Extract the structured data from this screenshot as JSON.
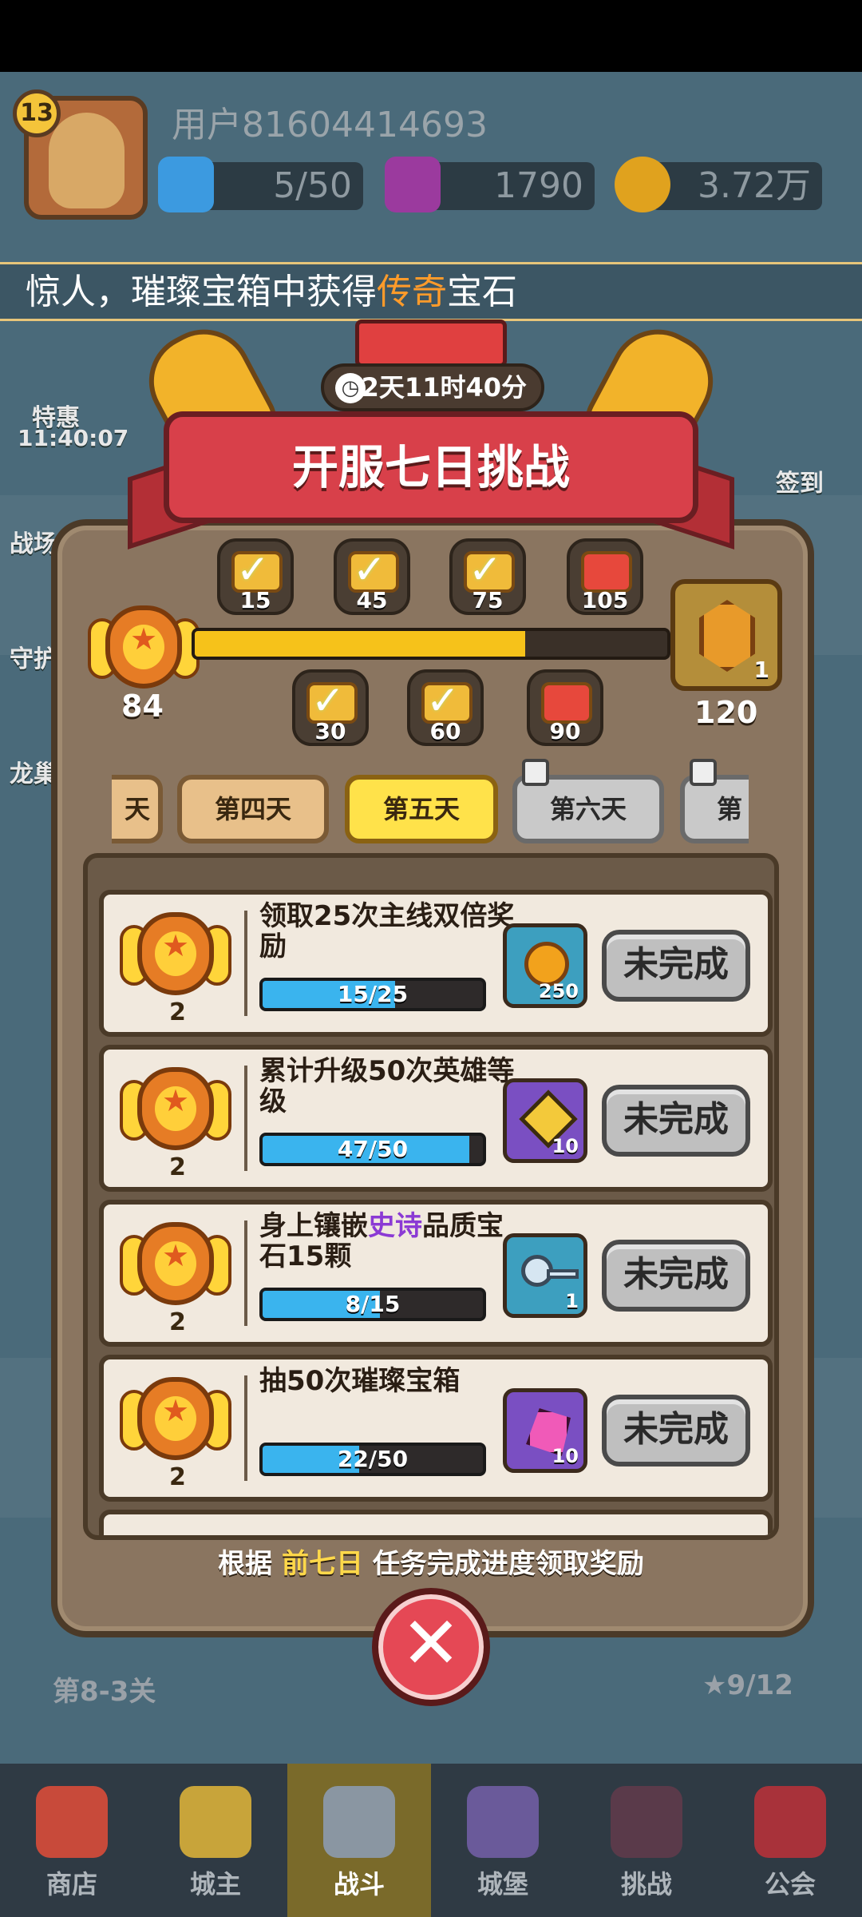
{
  "header": {
    "level": "13",
    "username": "用户81604414693",
    "energy": "5/50",
    "gems": "1790",
    "gold": "3.72万"
  },
  "marquee": {
    "prefix": "惊人，璀璨宝箱中获得",
    "highlight": "传奇",
    "suffix": "宝石"
  },
  "side": {
    "promo_label": "特惠",
    "promo_timer": "11:40:07",
    "brothers": "战场兄弟",
    "guard": "守护",
    "dragon": "龙巢",
    "signin": "签到"
  },
  "modal": {
    "timer": "2天11时40分",
    "title": "开服七日挑战",
    "current_points": "84",
    "max_points": "120",
    "progress_fraction": 0.7,
    "final_reward_count": "1",
    "milestones_top": [
      {
        "points": "15",
        "claimed": true
      },
      {
        "points": "45",
        "claimed": true
      },
      {
        "points": "75",
        "claimed": true
      },
      {
        "points": "105",
        "claimed": false
      }
    ],
    "milestones_bottom": [
      {
        "points": "30",
        "claimed": true
      },
      {
        "points": "60",
        "claimed": true
      },
      {
        "points": "90",
        "claimed": false
      }
    ],
    "tabs": [
      {
        "label": "天",
        "state": "day"
      },
      {
        "label": "第四天",
        "state": "day"
      },
      {
        "label": "第五天",
        "state": "active"
      },
      {
        "label": "第六天",
        "state": "locked"
      },
      {
        "label": "第七",
        "state": "locked"
      }
    ],
    "tasks": [
      {
        "title": "领取25次主线双倍奖励",
        "points": "2",
        "progress": "15/25",
        "ratio": 0.6,
        "reward_count": "250",
        "reward_icon": "gold-coin",
        "button": "未完成"
      },
      {
        "title": "累计升级50次英雄等级",
        "points": "2",
        "progress": "47/50",
        "ratio": 0.94,
        "reward_count": "10",
        "reward_icon": "mystery-puzzle",
        "button": "未完成"
      },
      {
        "title_pre": "身上镶嵌",
        "title_epic": "史诗",
        "title_post": "品质宝石15颗",
        "points": "2",
        "progress": "8/15",
        "ratio": 0.533,
        "reward_count": "1",
        "reward_icon": "key",
        "button": "未完成"
      },
      {
        "title": "抽50次璀璨宝箱",
        "points": "2",
        "progress": "22/50",
        "ratio": 0.44,
        "reward_count": "10",
        "reward_icon": "pink-gem",
        "button": "未完成"
      }
    ],
    "footer_pre": "根据",
    "footer_hl": "前七日",
    "footer_post": "任务完成进度领取奖励",
    "colors": {
      "accent_gold": "#f6c21a",
      "bar_blue": "#3ab4ee",
      "epic_purple": "#8b3ad4",
      "close_red": "#e54855"
    }
  },
  "background": {
    "stage_left": "第8-3关",
    "stars": "9/12"
  },
  "nav": [
    {
      "label": "商店",
      "icon": "shop-icon"
    },
    {
      "label": "城主",
      "icon": "crown-icon"
    },
    {
      "label": "战斗",
      "icon": "swords-icon",
      "active": true
    },
    {
      "label": "城堡",
      "icon": "castle-icon"
    },
    {
      "label": "挑战",
      "icon": "devil-icon"
    },
    {
      "label": "公会",
      "icon": "guild-icon"
    }
  ]
}
